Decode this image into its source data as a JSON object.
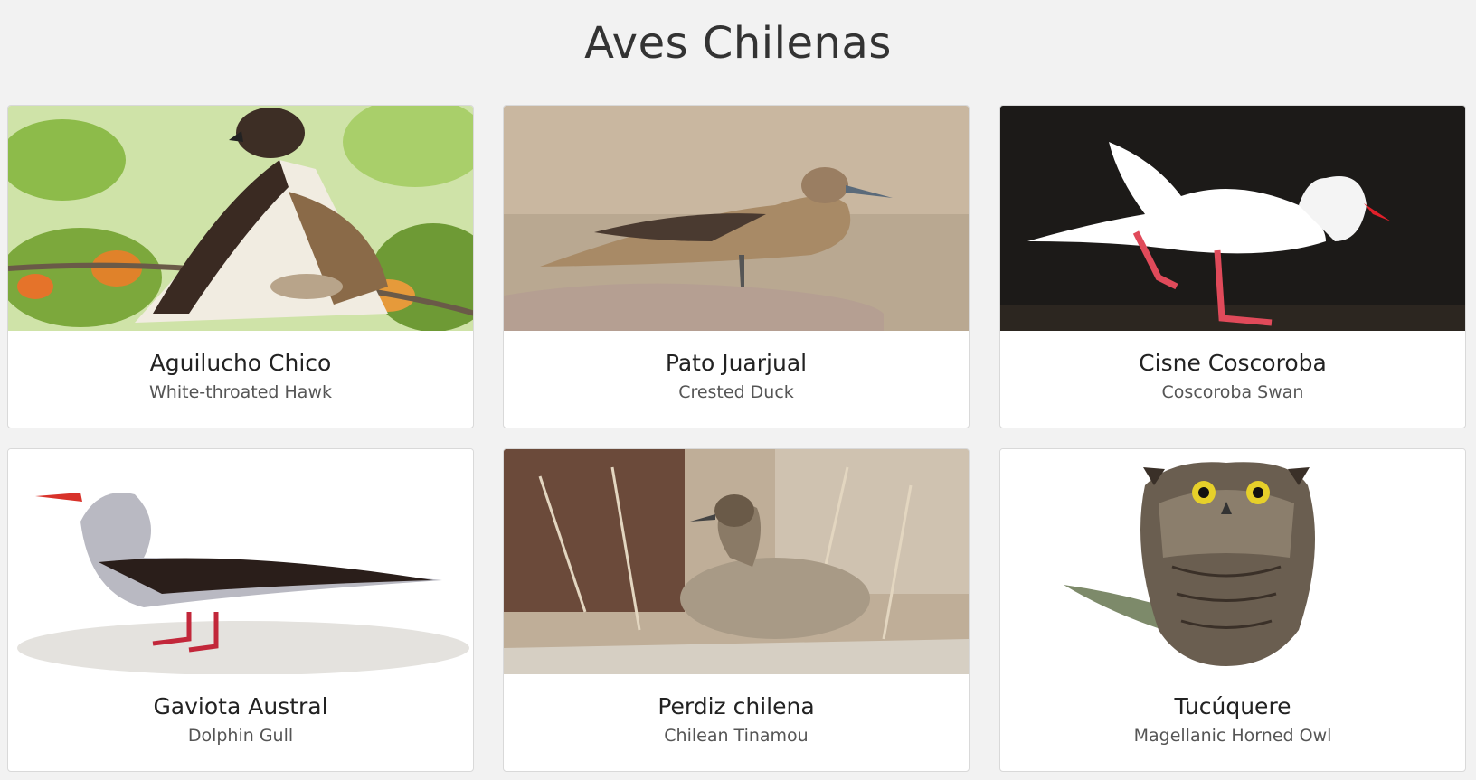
{
  "page": {
    "title": "Aves Chilenas"
  },
  "birds": [
    {
      "name": "Aguilucho Chico",
      "english": "White-throated Hawk",
      "image_icon": "hawk-photo-icon"
    },
    {
      "name": "Pato Juarjual",
      "english": "Crested Duck",
      "image_icon": "duck-photo-icon"
    },
    {
      "name": "Cisne Coscoroba",
      "english": "Coscoroba Swan",
      "image_icon": "swan-photo-icon"
    },
    {
      "name": "Gaviota Austral",
      "english": "Dolphin Gull",
      "image_icon": "gull-photo-icon"
    },
    {
      "name": "Perdiz chilena",
      "english": "Chilean Tinamou",
      "image_icon": "tinamou-photo-icon"
    },
    {
      "name": "Tucúquere",
      "english": "Magellanic Horned Owl",
      "image_icon": "owl-photo-icon"
    }
  ],
  "colors": {
    "background": "#f2f2f2",
    "card": "#ffffff",
    "title": "#333333",
    "subtitle": "#555555"
  }
}
